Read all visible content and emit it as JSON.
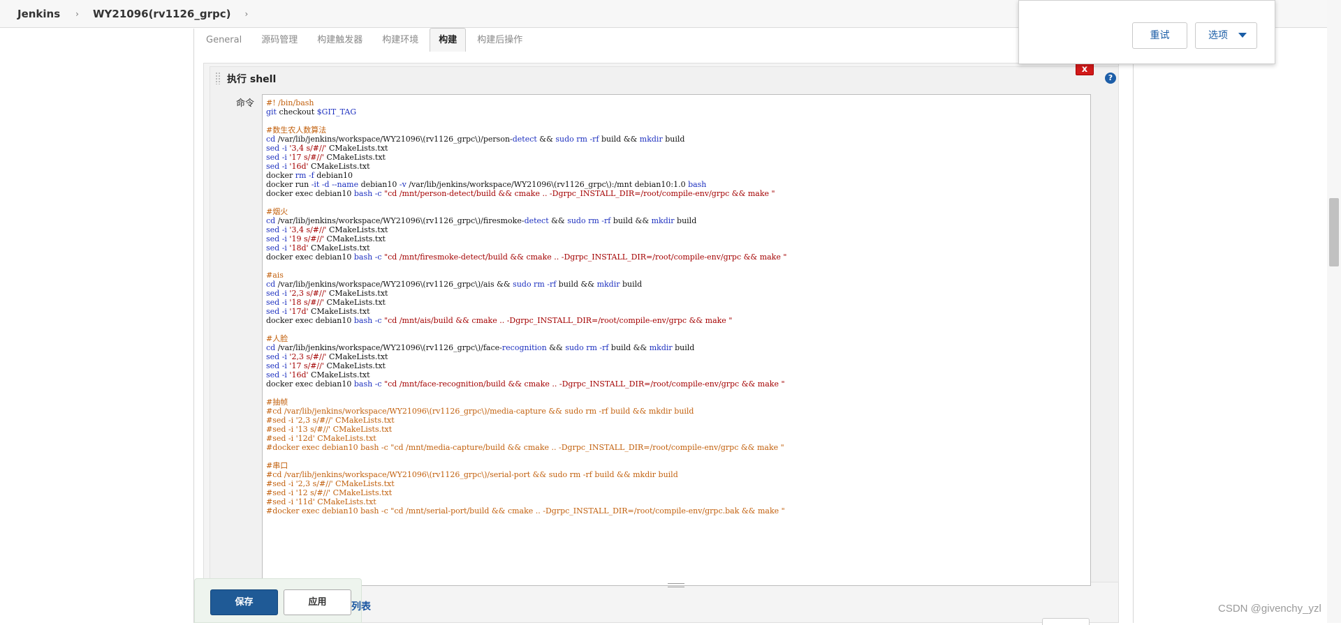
{
  "breadcrumb": {
    "root": "Jenkins",
    "job": "WY21096(rv1126_grpc)",
    "sep": "›"
  },
  "tabs": [
    {
      "label": "General"
    },
    {
      "label": "源码管理"
    },
    {
      "label": "构建触发器"
    },
    {
      "label": "构建环境"
    },
    {
      "label": "构建",
      "active": true
    },
    {
      "label": "构建后操作"
    }
  ],
  "popup": {
    "retry": "重试",
    "options": "选项"
  },
  "step": {
    "title": "执行 shell",
    "delete": "x",
    "help": "?",
    "command_label": "命令"
  },
  "code_lines": [
    [
      {
        "t": "#! /bin/bash",
        "c": "cmt"
      }
    ],
    [
      {
        "t": "git",
        "c": "kw"
      },
      {
        "t": " checkout "
      },
      {
        "t": "$GIT_TAG",
        "c": "kw"
      }
    ],
    [
      {
        "t": ""
      }
    ],
    [
      {
        "t": "#数生农人数算法",
        "c": "cmt"
      }
    ],
    [
      {
        "t": "cd",
        "c": "kw"
      },
      {
        "t": " /var/lib/jenkins/workspace/WY21096\\(rv1126_grpc\\)/person-"
      },
      {
        "t": "detect",
        "c": "kw"
      },
      {
        "t": " && "
      },
      {
        "t": "sudo rm -rf",
        "c": "kw"
      },
      {
        "t": " build && "
      },
      {
        "t": "mkdir",
        "c": "kw"
      },
      {
        "t": " build"
      }
    ],
    [
      {
        "t": "sed -i",
        "c": "kw"
      },
      {
        "t": " '3,4 s/#//'",
        "c": "str"
      },
      {
        "t": " CMakeLists.txt"
      }
    ],
    [
      {
        "t": "sed -i",
        "c": "kw"
      },
      {
        "t": " '17 s/#//'",
        "c": "str"
      },
      {
        "t": " CMakeLists.txt"
      }
    ],
    [
      {
        "t": "sed -i",
        "c": "kw"
      },
      {
        "t": " '16d'",
        "c": "str"
      },
      {
        "t": " CMakeLists.txt"
      }
    ],
    [
      {
        "t": "docker "
      },
      {
        "t": "rm -f",
        "c": "kw"
      },
      {
        "t": " debian10"
      }
    ],
    [
      {
        "t": "docker run "
      },
      {
        "t": "-it -d --name",
        "c": "kw"
      },
      {
        "t": " debian10 "
      },
      {
        "t": "-v",
        "c": "kw"
      },
      {
        "t": " /var/lib/jenkins/workspace/WY21096\\(rv1126_grpc\\):/mnt debian10:1.0 "
      },
      {
        "t": "bash",
        "c": "kw"
      }
    ],
    [
      {
        "t": "docker exec debian10 "
      },
      {
        "t": "bash -c",
        "c": "kw"
      },
      {
        "t": " \"cd /mnt/person-detect/build && cmake .. -Dgrpc_INSTALL_DIR=/root/compile-env/grpc && make \"",
        "c": "str"
      }
    ],
    [
      {
        "t": ""
      }
    ],
    [
      {
        "t": "#烟火",
        "c": "cmt"
      }
    ],
    [
      {
        "t": "cd",
        "c": "kw"
      },
      {
        "t": " /var/lib/jenkins/workspace/WY21096\\(rv1126_grpc\\)/firesmoke-"
      },
      {
        "t": "detect",
        "c": "kw"
      },
      {
        "t": " && "
      },
      {
        "t": "sudo rm -rf",
        "c": "kw"
      },
      {
        "t": " build && "
      },
      {
        "t": "mkdir",
        "c": "kw"
      },
      {
        "t": " build"
      }
    ],
    [
      {
        "t": "sed -i",
        "c": "kw"
      },
      {
        "t": " '3,4 s/#//'",
        "c": "str"
      },
      {
        "t": " CMakeLists.txt"
      }
    ],
    [
      {
        "t": "sed -i",
        "c": "kw"
      },
      {
        "t": " '19 s/#//'",
        "c": "str"
      },
      {
        "t": " CMakeLists.txt"
      }
    ],
    [
      {
        "t": "sed -i",
        "c": "kw"
      },
      {
        "t": " '18d'",
        "c": "str"
      },
      {
        "t": " CMakeLists.txt"
      }
    ],
    [
      {
        "t": "docker exec debian10 "
      },
      {
        "t": "bash -c",
        "c": "kw"
      },
      {
        "t": " \"cd /mnt/firesmoke-detect/build && cmake .. -Dgrpc_INSTALL_DIR=/root/compile-env/grpc && make \"",
        "c": "str"
      }
    ],
    [
      {
        "t": ""
      }
    ],
    [
      {
        "t": "#ais",
        "c": "cmt"
      }
    ],
    [
      {
        "t": "cd",
        "c": "kw"
      },
      {
        "t": " /var/lib/jenkins/workspace/WY21096\\(rv1126_grpc\\)/ais && "
      },
      {
        "t": "sudo rm -rf",
        "c": "kw"
      },
      {
        "t": " build && "
      },
      {
        "t": "mkdir",
        "c": "kw"
      },
      {
        "t": " build"
      }
    ],
    [
      {
        "t": "sed -i",
        "c": "kw"
      },
      {
        "t": " '2,3 s/#//'",
        "c": "str"
      },
      {
        "t": " CMakeLists.txt"
      }
    ],
    [
      {
        "t": "sed -i",
        "c": "kw"
      },
      {
        "t": " '18 s/#//'",
        "c": "str"
      },
      {
        "t": " CMakeLists.txt"
      }
    ],
    [
      {
        "t": "sed -i",
        "c": "kw"
      },
      {
        "t": " '17d'",
        "c": "str"
      },
      {
        "t": " CMakeLists.txt"
      }
    ],
    [
      {
        "t": "docker exec debian10 "
      },
      {
        "t": "bash -c",
        "c": "kw"
      },
      {
        "t": " \"cd /mnt/ais/build && cmake .. -Dgrpc_INSTALL_DIR=/root/compile-env/grpc && make \"",
        "c": "str"
      }
    ],
    [
      {
        "t": ""
      }
    ],
    [
      {
        "t": "#人脸",
        "c": "cmt"
      }
    ],
    [
      {
        "t": "cd",
        "c": "kw"
      },
      {
        "t": " /var/lib/jenkins/workspace/WY21096\\(rv1126_grpc\\)/face-"
      },
      {
        "t": "recognition",
        "c": "kw"
      },
      {
        "t": " && "
      },
      {
        "t": "sudo rm -rf",
        "c": "kw"
      },
      {
        "t": " build && "
      },
      {
        "t": "mkdir",
        "c": "kw"
      },
      {
        "t": " build"
      }
    ],
    [
      {
        "t": "sed -i",
        "c": "kw"
      },
      {
        "t": " '2,3 s/#//'",
        "c": "str"
      },
      {
        "t": " CMakeLists.txt"
      }
    ],
    [
      {
        "t": "sed -i",
        "c": "kw"
      },
      {
        "t": " '17 s/#//'",
        "c": "str"
      },
      {
        "t": " CMakeLists.txt"
      }
    ],
    [
      {
        "t": "sed -i",
        "c": "kw"
      },
      {
        "t": " '16d'",
        "c": "str"
      },
      {
        "t": " CMakeLists.txt"
      }
    ],
    [
      {
        "t": "docker exec debian10 "
      },
      {
        "t": "bash -c",
        "c": "kw"
      },
      {
        "t": " \"cd /mnt/face-recognition/build && cmake .. -Dgrpc_INSTALL_DIR=/root/compile-env/grpc && make \"",
        "c": "str"
      }
    ],
    [
      {
        "t": ""
      }
    ],
    [
      {
        "t": "#抽帧",
        "c": "cmt"
      }
    ],
    [
      {
        "t": "#cd /var/lib/jenkins/workspace/WY21096\\(rv1126_grpc\\)/media-capture && sudo rm -rf build && mkdir build",
        "c": "cmt"
      }
    ],
    [
      {
        "t": "#sed -i '2,3 s/#//' CMakeLists.txt",
        "c": "cmt"
      }
    ],
    [
      {
        "t": "#sed -i '13 s/#//' CMakeLists.txt",
        "c": "cmt"
      }
    ],
    [
      {
        "t": "#sed -i '12d' CMakeLists.txt",
        "c": "cmt"
      }
    ],
    [
      {
        "t": "#docker exec debian10 bash -c \"cd /mnt/media-capture/build && cmake .. -Dgrpc_INSTALL_DIR=/root/compile-env/grpc && make \"",
        "c": "cmt"
      }
    ],
    [
      {
        "t": ""
      }
    ],
    [
      {
        "t": "#串口",
        "c": "cmt"
      }
    ],
    [
      {
        "t": "#cd /var/lib/jenkins/workspace/WY21096\\(rv1126_grpc\\)/serial-port && sudo rm -rf build && mkdir build",
        "c": "cmt"
      }
    ],
    [
      {
        "t": "#sed -i '2,3 s/#//' CMakeLists.txt",
        "c": "cmt"
      }
    ],
    [
      {
        "t": "#sed -i '12 s/#//' CMakeLists.txt",
        "c": "cmt"
      }
    ],
    [
      {
        "t": "#sed -i '11d' CMakeLists.txt",
        "c": "cmt"
      }
    ],
    [
      {
        "t": "#docker exec debian10 bash -c \"cd /mnt/serial-port/build && cmake .. -Dgrpc_INSTALL_DIR=/root/compile-env/grpc.bak && make \"",
        "c": "cmt"
      }
    ]
  ],
  "bottom": {
    "save": "保存",
    "apply": "应用",
    "add_step_partial": "列表"
  },
  "watermark": "CSDN @givenchy_yzl",
  "colors": {
    "save_bg": "#1f5a96",
    "delete_bg": "#d11a1a",
    "keyword": "#1c2fbf",
    "string": "#a30000",
    "comment": "#c2600d"
  }
}
